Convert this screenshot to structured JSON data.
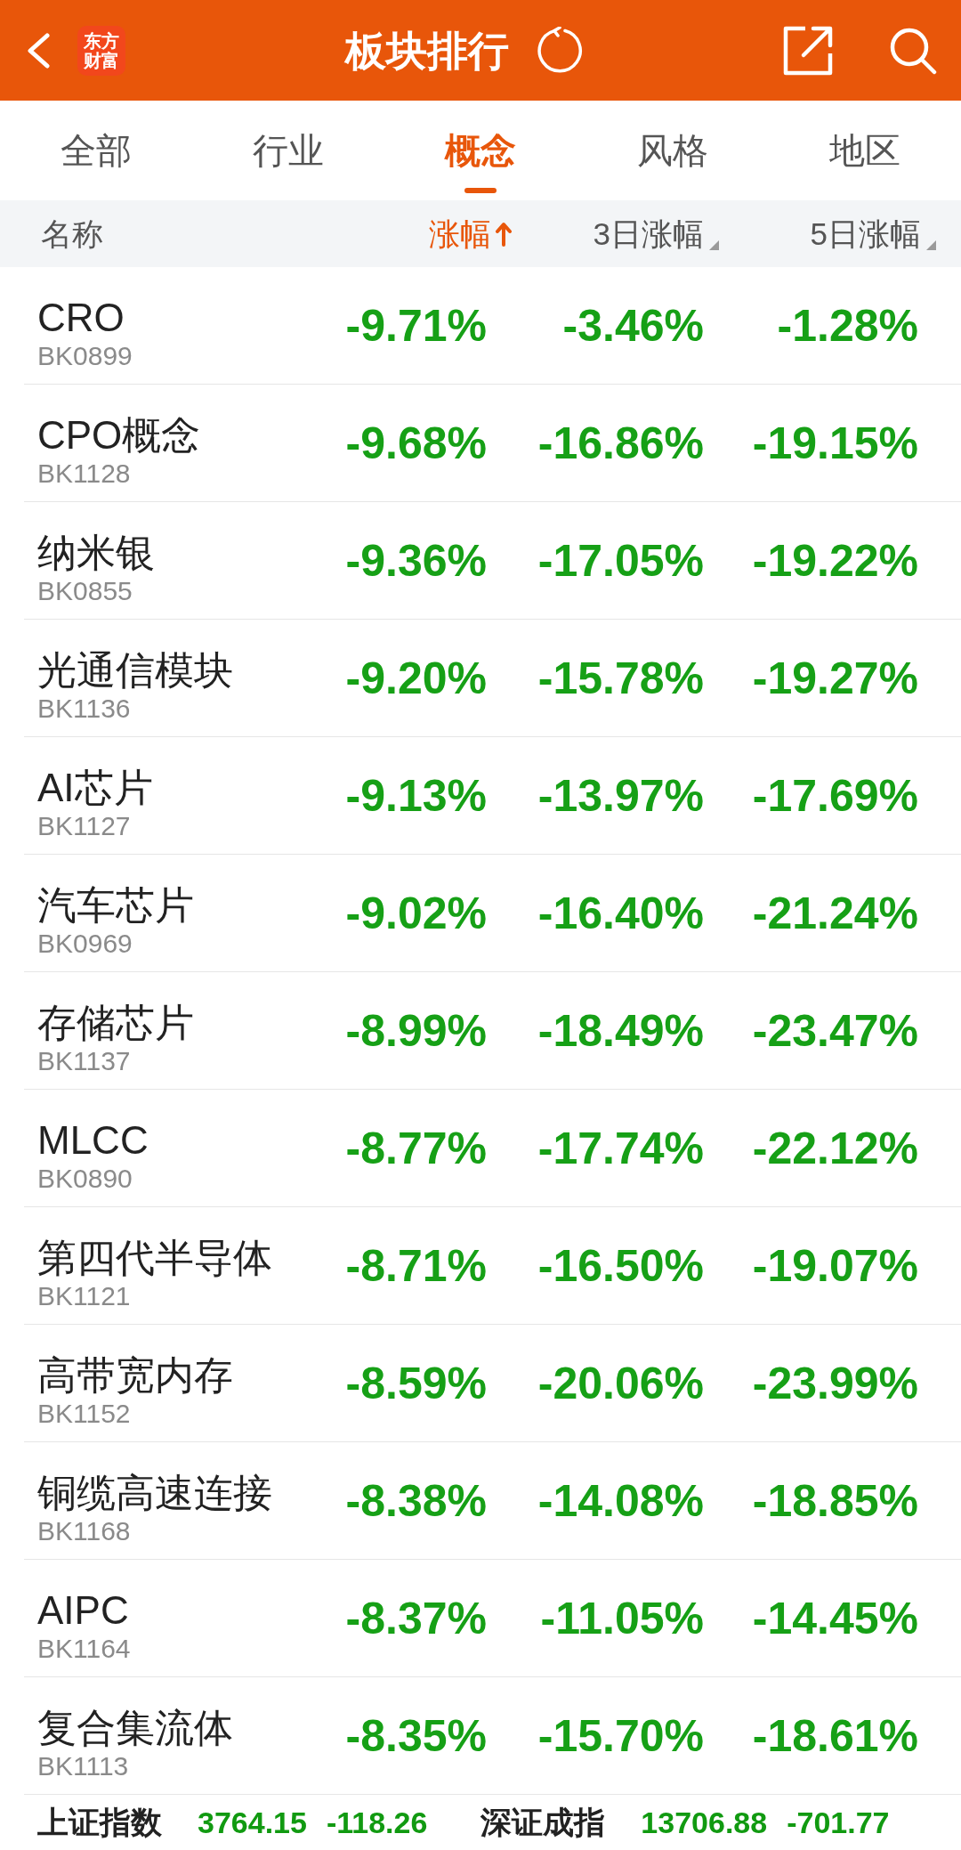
{
  "header": {
    "logo": [
      "东方",
      "财富"
    ],
    "title": "板块排行"
  },
  "tabs": [
    {
      "label": "全部",
      "selected": false
    },
    {
      "label": "行业",
      "selected": false
    },
    {
      "label": "概念",
      "selected": true
    },
    {
      "label": "风格",
      "selected": false
    },
    {
      "label": "地区",
      "selected": false
    }
  ],
  "table": {
    "columns": [
      {
        "label": "名称",
        "kind": "name",
        "selected": false
      },
      {
        "label": "涨幅",
        "kind": "sortable",
        "selected": true,
        "ascending": true
      },
      {
        "label": "3日涨幅",
        "kind": "sortable",
        "selected": false
      },
      {
        "label": "5日涨幅",
        "kind": "sortable",
        "selected": false
      }
    ],
    "rows": [
      {
        "name": "CRO",
        "code": "BK0899",
        "values": [
          "-9.71%",
          "-3.46%",
          "-1.28%"
        ]
      },
      {
        "name": "CPO概念",
        "code": "BK1128",
        "values": [
          "-9.68%",
          "-16.86%",
          "-19.15%"
        ]
      },
      {
        "name": "纳米银",
        "code": "BK0855",
        "values": [
          "-9.36%",
          "-17.05%",
          "-19.22%"
        ]
      },
      {
        "name": "光通信模块",
        "code": "BK1136",
        "values": [
          "-9.20%",
          "-15.78%",
          "-19.27%"
        ]
      },
      {
        "name": "AI芯片",
        "code": "BK1127",
        "values": [
          "-9.13%",
          "-13.97%",
          "-17.69%"
        ]
      },
      {
        "name": "汽车芯片",
        "code": "BK0969",
        "values": [
          "-9.02%",
          "-16.40%",
          "-21.24%"
        ]
      },
      {
        "name": "存储芯片",
        "code": "BK1137",
        "values": [
          "-8.99%",
          "-18.49%",
          "-23.47%"
        ]
      },
      {
        "name": "MLCC",
        "code": "BK0890",
        "values": [
          "-8.77%",
          "-17.74%",
          "-22.12%"
        ]
      },
      {
        "name": "第四代半导体",
        "code": "BK1121",
        "values": [
          "-8.71%",
          "-16.50%",
          "-19.07%"
        ]
      },
      {
        "name": "高带宽内存",
        "code": "BK1152",
        "values": [
          "-8.59%",
          "-20.06%",
          "-23.99%"
        ]
      },
      {
        "name": "铜缆高速连接",
        "code": "BK1168",
        "values": [
          "-8.38%",
          "-14.08%",
          "-18.85%"
        ]
      },
      {
        "name": "AIPC",
        "code": "BK1164",
        "values": [
          "-8.37%",
          "-11.05%",
          "-14.45%"
        ]
      },
      {
        "name": "复合集流体",
        "code": "BK1113",
        "values": [
          "-8.35%",
          "-15.70%",
          "-18.61%"
        ]
      }
    ]
  },
  "index_bar": [
    {
      "name": "上证指数",
      "value": "3764.15",
      "change": "-118.26"
    },
    {
      "name": "深证成指",
      "value": "13706.88",
      "change": "-701.77"
    }
  ]
}
